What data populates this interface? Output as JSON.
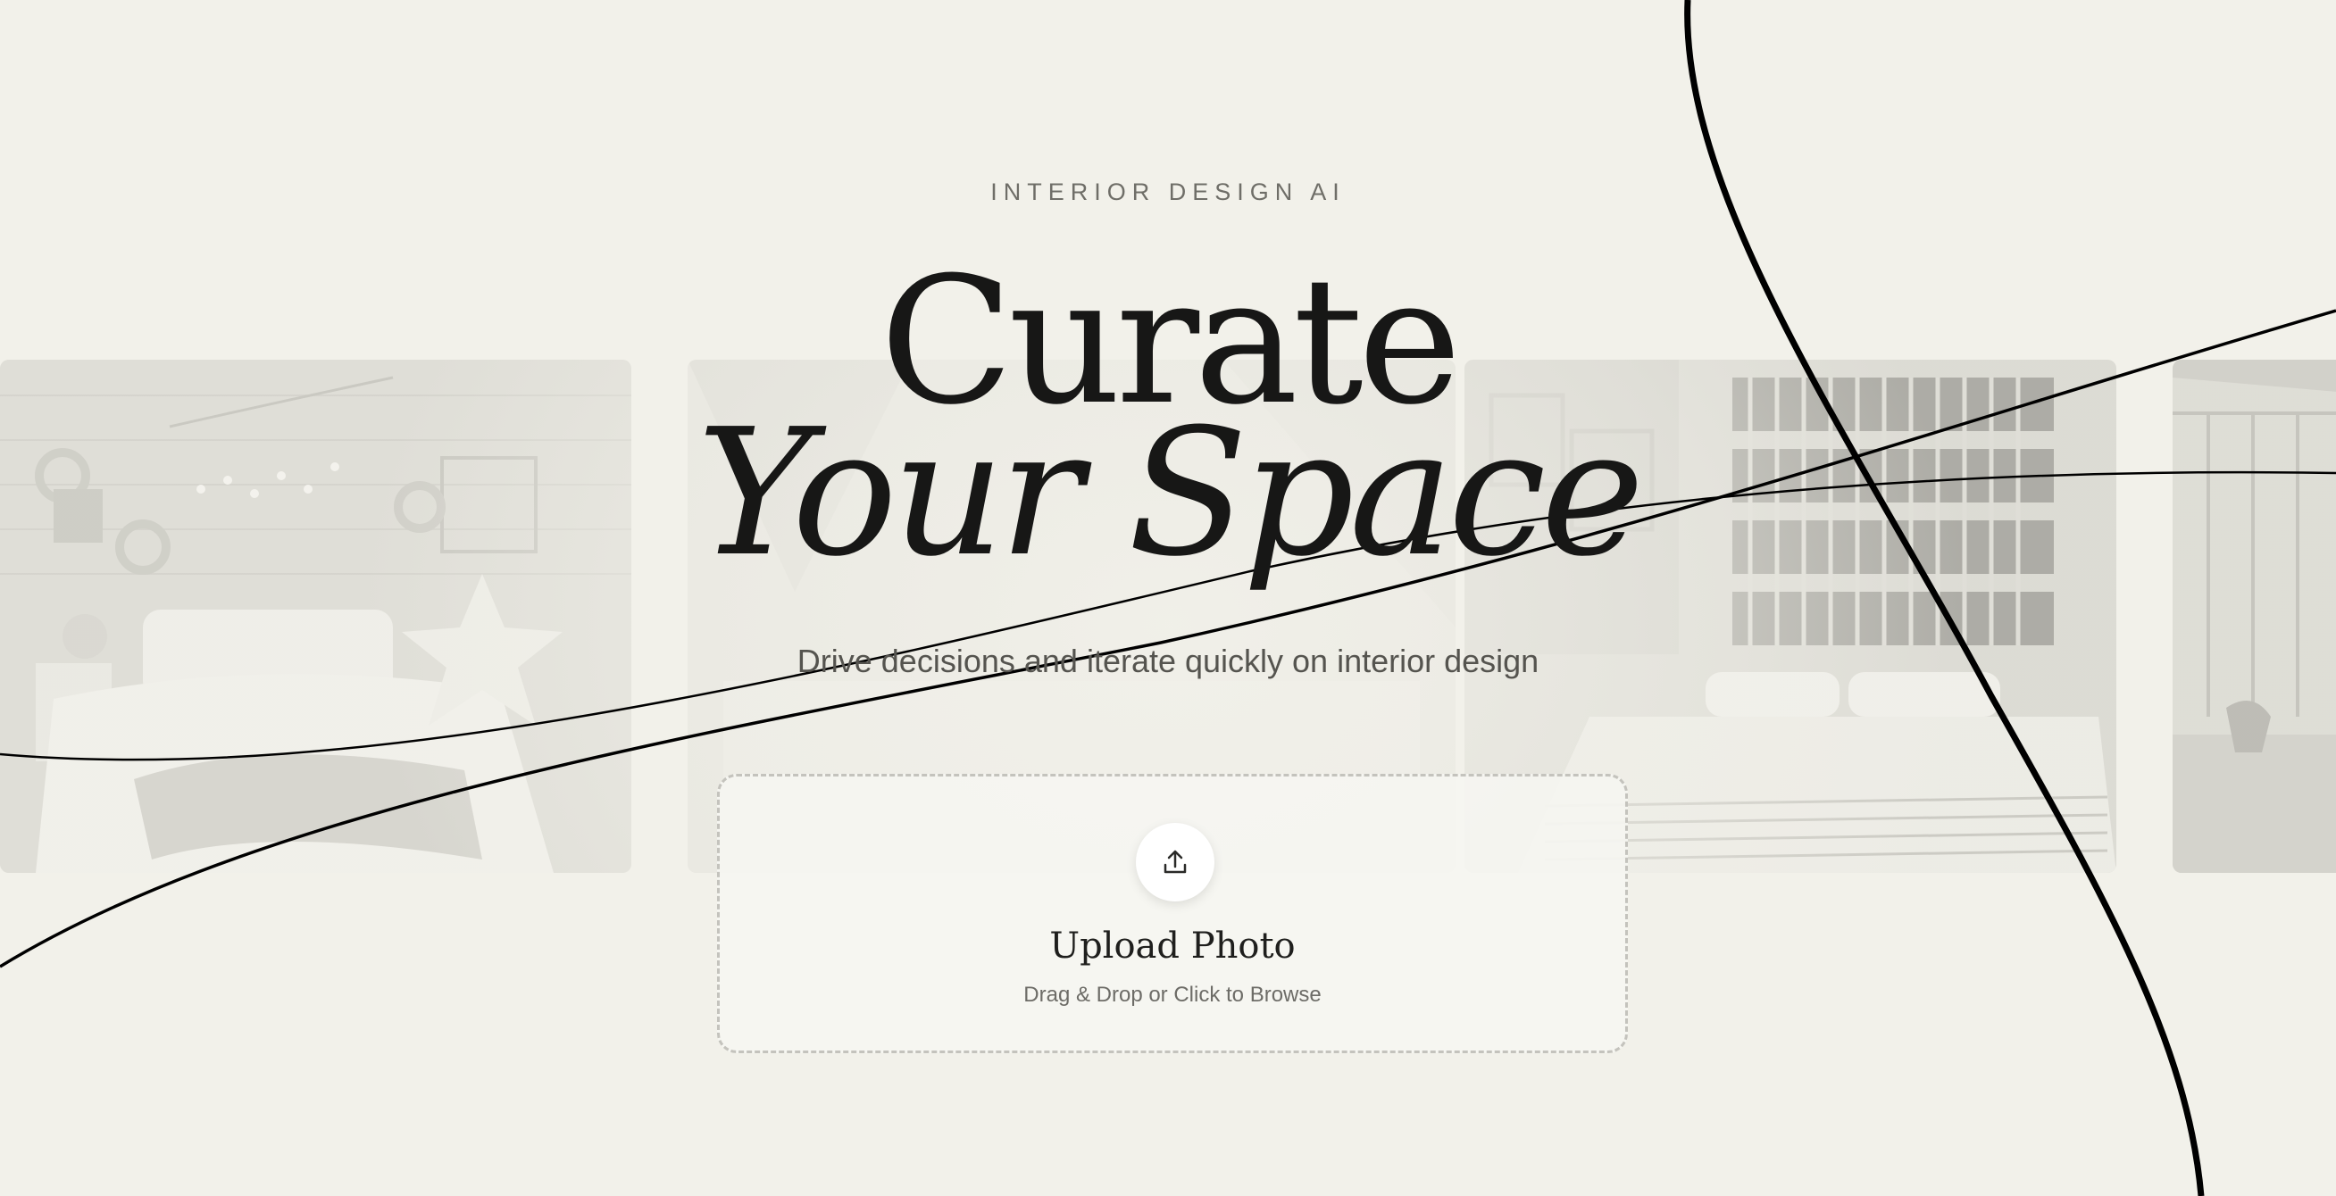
{
  "hero": {
    "eyebrow": "INTERIOR DESIGN AI",
    "title_line1": "Curate",
    "title_line2": "Your Space",
    "subtitle": "Drive decisions and iterate quickly on interior design"
  },
  "upload": {
    "icon": "upload-icon",
    "title": "Upload Photo",
    "hint": "Drag & Drop or Click to Browse"
  },
  "gallery": {
    "images": [
      "bedroom-string-lights-image",
      "bedroom-soft-interior-image",
      "bedroom-bookshelves-image",
      "bedroom-window-image"
    ]
  },
  "colors": {
    "background": "#f2f1ea",
    "text": "#171716",
    "muted": "#6f6e68",
    "accent_line": "#000000"
  }
}
